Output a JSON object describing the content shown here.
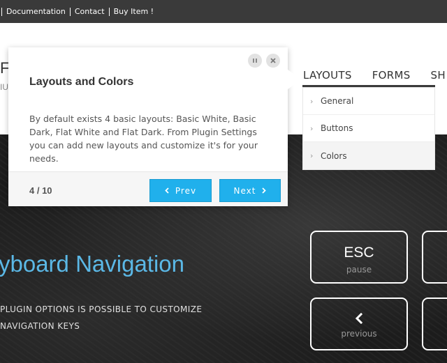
{
  "topbar": {
    "links": [
      "Documentation",
      "Contact",
      "Buy Item !"
    ],
    "color": "#3a3a3a"
  },
  "header": {
    "brand_partial": "F",
    "brand_sub_partial": "IU"
  },
  "nav": {
    "items": [
      "LAYOUTS",
      "FORMS",
      "SH"
    ],
    "active": "LAYOUTS"
  },
  "dropdown": {
    "items": [
      "General",
      "Buttons",
      "Colors"
    ],
    "selected": "Colors"
  },
  "hero": {
    "title": "yboard Navigation",
    "text_line1": "PLUGIN OPTIONS IS POSSIBLE TO CUSTOMIZE",
    "text_line2": "NAVIGATION KEYS",
    "title_color": "#5bb8e6",
    "keys": [
      {
        "main": "ESC",
        "sub": "pause"
      },
      {
        "icon": "chevron-left-icon",
        "sub": "previous"
      }
    ]
  },
  "popup": {
    "title": "Layouts and Colors",
    "body": "By default exists 4 basic layouts: Basic White, Basic Dark, Flat White and Flat Dark. From Plugin Settings you can add new layouts and customize it's for your needs.",
    "counter": "4 / 10",
    "prev_label": "Prev",
    "next_label": "Next",
    "button_color": "#20b0ec",
    "controls": [
      "pause-icon",
      "close-icon"
    ]
  }
}
